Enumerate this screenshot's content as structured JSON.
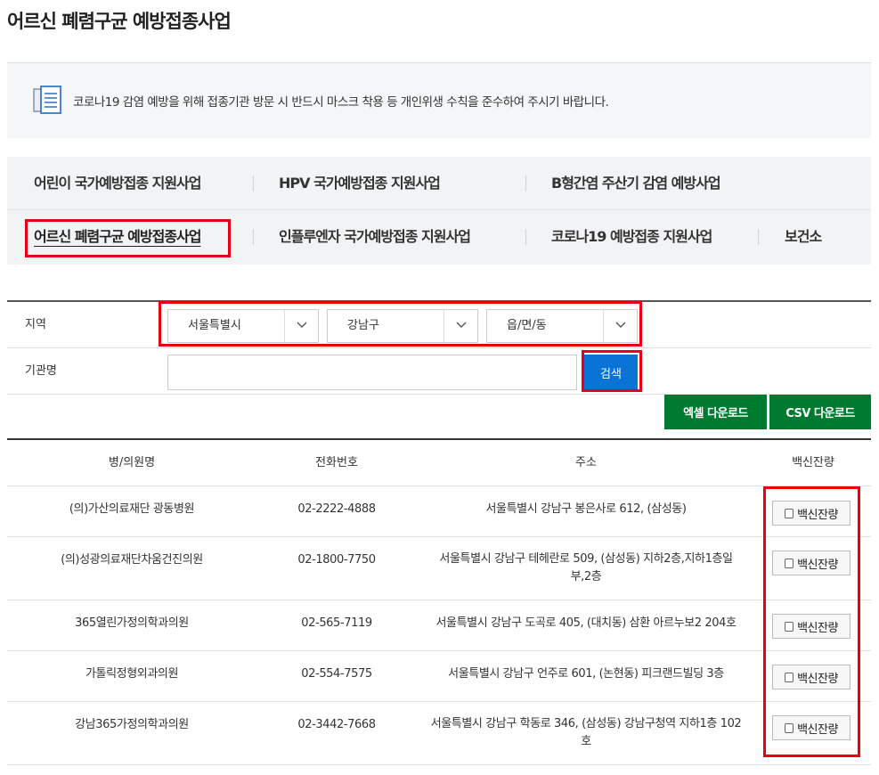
{
  "page": {
    "title": "어르신 폐렴구균 예방접종사업"
  },
  "notice": {
    "text": "코로나19 감염 예방을 위해 접종기관 방문 시 반드시 마스크 착용 등 개인위생 수칙을 준수하여 주시기 바랍니다.",
    "icon": "document-list-icon"
  },
  "tabs": {
    "row1": [
      "어린이 국가예방접종 지원사업",
      "HPV 국가예방접종 지원사업",
      "B형간염 주산기 감염 예방사업"
    ],
    "row2": [
      "어르신 폐렴구균 예방접종사업",
      "인플루엔자 국가예방접종 지원사업",
      "코로나19 예방접종 지원사업",
      "보건소"
    ],
    "active": "어르신 폐렴구균 예방접종사업"
  },
  "search": {
    "region_label": "지역",
    "name_label": "기관명",
    "city": "서울특별시",
    "district": "강남구",
    "town": "읍/면/동",
    "name_value": "",
    "search_button": "검색"
  },
  "downloads": {
    "excel": "엑셀 다운로드",
    "csv": "CSV 다운로드"
  },
  "table": {
    "headers": {
      "name": "병/의원명",
      "phone": "전화번호",
      "address": "주소",
      "vaccine": "백신잔량"
    },
    "vaccine_button": "백신잔량",
    "rows": [
      {
        "name": "(의)가산의료재단 광동병원",
        "phone": "02-2222-4888",
        "address": "서울특별시 강남구 봉은사로 612, (삼성동)"
      },
      {
        "name": "(의)성광의료재단차움건진의원",
        "phone": "02-1800-7750",
        "address": "서울특별시 강남구 테헤란로 509, (삼성동) 지하2층,지하1층일부,2층"
      },
      {
        "name": "365열린가정의학과의원",
        "phone": "02-565-7119",
        "address": "서울특별시 강남구 도곡로 405, (대치동) 삼환 아르누보2 204호"
      },
      {
        "name": "가톨릭정형외과의원",
        "phone": "02-554-7575",
        "address": "서울특별시 강남구 언주로 601, (논현동) 피크랜드빌딩 3층"
      },
      {
        "name": "강남365가정의학과의원",
        "phone": "02-3442-7668",
        "address": "서울특별시 강남구 학동로 346, (삼성동) 강남구청역 지하1층 102호"
      }
    ]
  },
  "colors": {
    "search_button": "#0a74d6",
    "download_button": "#007a2f",
    "highlight": "#e60012"
  }
}
